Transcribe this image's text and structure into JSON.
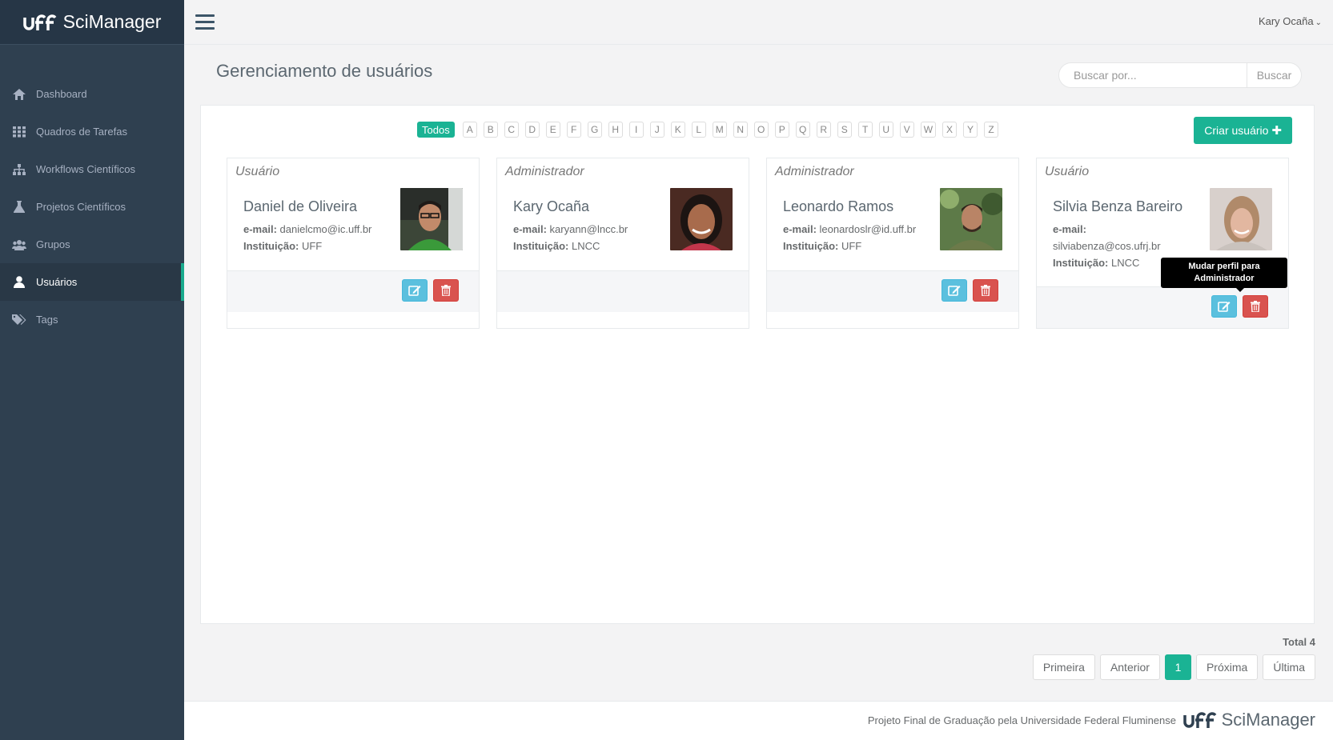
{
  "app": {
    "name": "SciManager"
  },
  "sidebar": {
    "items": [
      {
        "label": "Dashboard",
        "icon": "home-icon"
      },
      {
        "label": "Quadros de Tarefas",
        "icon": "grid-icon"
      },
      {
        "label": "Workflows Científicos",
        "icon": "sitemap-icon"
      },
      {
        "label": "Projetos Científicos",
        "icon": "flask-icon"
      },
      {
        "label": "Grupos",
        "icon": "users-icon"
      },
      {
        "label": "Usuários",
        "icon": "user-icon",
        "active": true
      },
      {
        "label": "Tags",
        "icon": "tags-icon"
      }
    ]
  },
  "topbar": {
    "user_name": "Kary Ocaña"
  },
  "page": {
    "title": "Gerenciamento de usuários",
    "search_placeholder": "Buscar por...",
    "search_button": "Buscar",
    "create_button": "Criar usuário"
  },
  "letters": [
    "Todos",
    "A",
    "B",
    "C",
    "D",
    "E",
    "F",
    "G",
    "H",
    "I",
    "J",
    "K",
    "L",
    "M",
    "N",
    "O",
    "P",
    "Q",
    "R",
    "S",
    "T",
    "U",
    "V",
    "W",
    "X",
    "Y",
    "Z"
  ],
  "labels": {
    "email": "e-mail:",
    "institution": "Instituição:"
  },
  "users": [
    {
      "role": "Usuário",
      "name": "Daniel de Oliveira",
      "email": "danielcmo@ic.uff.br",
      "institution": "UFF",
      "actions": true
    },
    {
      "role": "Administrador",
      "name": "Kary Ocaña",
      "email": "karyann@lncc.br",
      "institution": "LNCC",
      "actions": false
    },
    {
      "role": "Administrador",
      "name": "Leonardo Ramos",
      "email": "leonardoslr@id.uff.br",
      "institution": "UFF",
      "actions": true
    },
    {
      "role": "Usuário",
      "name": "Silvia Benza Bareiro",
      "email": "silviabenza@cos.ufrj.br",
      "institution": "LNCC",
      "actions": true
    }
  ],
  "tooltip": {
    "text": "Mudar perfil para Administrador"
  },
  "pagination": {
    "total": "Total 4",
    "first": "Primeira",
    "prev": "Anterior",
    "current": "1",
    "next": "Próxima",
    "last": "Última"
  },
  "footer": {
    "text": "Projeto Final de Graduação pela Universidade Federal Fluminense",
    "brand": "SciManager"
  },
  "colors": {
    "sidebar": "#2f4050",
    "accent": "#1ab394",
    "edit": "#5bc0de",
    "delete": "#d9534f"
  }
}
